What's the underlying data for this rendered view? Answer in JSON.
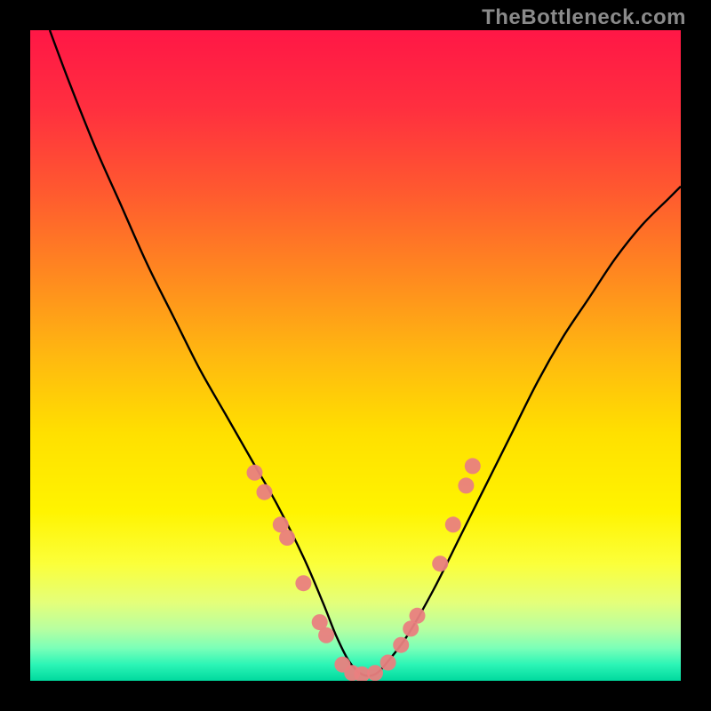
{
  "watermark": "TheBottleneck.com",
  "colors": {
    "bg_frame": "#000000",
    "gradient_stops": [
      {
        "offset": 0.0,
        "color": "#ff1746"
      },
      {
        "offset": 0.12,
        "color": "#ff2f3f"
      },
      {
        "offset": 0.25,
        "color": "#ff5a2f"
      },
      {
        "offset": 0.38,
        "color": "#ff8a1f"
      },
      {
        "offset": 0.5,
        "color": "#ffb810"
      },
      {
        "offset": 0.62,
        "color": "#ffe000"
      },
      {
        "offset": 0.74,
        "color": "#fff400"
      },
      {
        "offset": 0.82,
        "color": "#fbff3a"
      },
      {
        "offset": 0.88,
        "color": "#e4ff7a"
      },
      {
        "offset": 0.92,
        "color": "#b8ffa0"
      },
      {
        "offset": 0.95,
        "color": "#7affb8"
      },
      {
        "offset": 0.975,
        "color": "#2cf5b6"
      },
      {
        "offset": 1.0,
        "color": "#00d99e"
      }
    ],
    "curve": "#000000",
    "dot_fill": "#e98080",
    "dot_stroke": "#e98080"
  },
  "chart_data": {
    "type": "line",
    "title": "",
    "xlabel": "",
    "ylabel": "",
    "xlim": [
      0,
      100
    ],
    "ylim": [
      0,
      100
    ],
    "series": [
      {
        "name": "bottleneck-curve",
        "x": [
          3,
          6,
          10,
          14,
          18,
          22,
          26,
          30,
          34,
          38,
          42,
          45,
          47,
          49,
          51,
          53,
          55,
          58,
          62,
          66,
          70,
          74,
          78,
          82,
          86,
          90,
          94,
          98,
          100
        ],
        "y": [
          100,
          92,
          82,
          73,
          64,
          56,
          48,
          41,
          34,
          27,
          19,
          12,
          7,
          3,
          1,
          1,
          3,
          7,
          14,
          22,
          30,
          38,
          46,
          53,
          59,
          65,
          70,
          74,
          76
        ]
      }
    ],
    "scatter_points": {
      "name": "sample-dots",
      "points": [
        {
          "x": 34.5,
          "y": 32
        },
        {
          "x": 36.0,
          "y": 29
        },
        {
          "x": 38.5,
          "y": 24
        },
        {
          "x": 39.5,
          "y": 22
        },
        {
          "x": 42.0,
          "y": 15
        },
        {
          "x": 44.5,
          "y": 9
        },
        {
          "x": 45.5,
          "y": 7
        },
        {
          "x": 48.0,
          "y": 2.5
        },
        {
          "x": 49.5,
          "y": 1.2
        },
        {
          "x": 51.0,
          "y": 1.0
        },
        {
          "x": 53.0,
          "y": 1.2
        },
        {
          "x": 55.0,
          "y": 2.8
        },
        {
          "x": 57.0,
          "y": 5.5
        },
        {
          "x": 58.5,
          "y": 8
        },
        {
          "x": 59.5,
          "y": 10
        },
        {
          "x": 63.0,
          "y": 18
        },
        {
          "x": 65.0,
          "y": 24
        },
        {
          "x": 67.0,
          "y": 30
        },
        {
          "x": 68.0,
          "y": 33
        }
      ]
    }
  }
}
